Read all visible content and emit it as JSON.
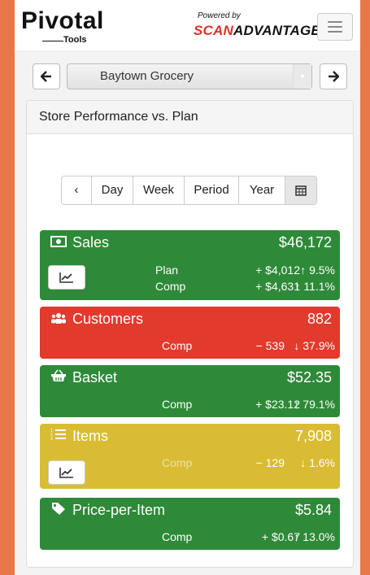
{
  "header": {
    "logo_text": "Pivotal",
    "logo_sub": "Tools",
    "powered_by": "Powered by",
    "brand_scan": "SCAN",
    "brand_adv": "ADVANTAGE"
  },
  "store_nav": {
    "prev_icon": "arrow-left-icon",
    "store_name": "Baytown Grocery",
    "next_icon": "arrow-right-icon"
  },
  "panel": {
    "title": "Store Performance vs. Plan"
  },
  "period_tabs": {
    "prev": "‹",
    "items": [
      "Day",
      "Week",
      "Period",
      "Year"
    ],
    "calendar_icon": "calendar-icon"
  },
  "metrics": {
    "sales": {
      "title": "Sales",
      "value": "$46,172",
      "plan_label": "Plan",
      "plan_value": "+ $4,012",
      "plan_pct": "↑ 9.5%",
      "comp_label": "Comp",
      "comp_value": "+ $4,631",
      "comp_pct": "↑ 11.1%",
      "color": "#2e8a38"
    },
    "customers": {
      "title": "Customers",
      "value": "882",
      "comp_label": "Comp",
      "comp_value": "− 539",
      "comp_pct": "↓ 37.9%",
      "color": "#e23a2c"
    },
    "basket": {
      "title": "Basket",
      "value": "$52.35",
      "comp_label": "Comp",
      "comp_value": "+ $23.12",
      "comp_pct": "↑ 79.1%",
      "color": "#2e8a38"
    },
    "items": {
      "title": "Items",
      "value": "7,908",
      "comp_label": "Comp",
      "comp_value": "− 129",
      "comp_pct": "↓ 1.6%",
      "color": "#d9bc33"
    },
    "ppi": {
      "title": "Price-per-Item",
      "value": "$5.84",
      "comp_label": "Comp",
      "comp_value": "+ $0.67",
      "comp_pct": "↑ 13.0%",
      "color": "#2e8a38"
    }
  }
}
